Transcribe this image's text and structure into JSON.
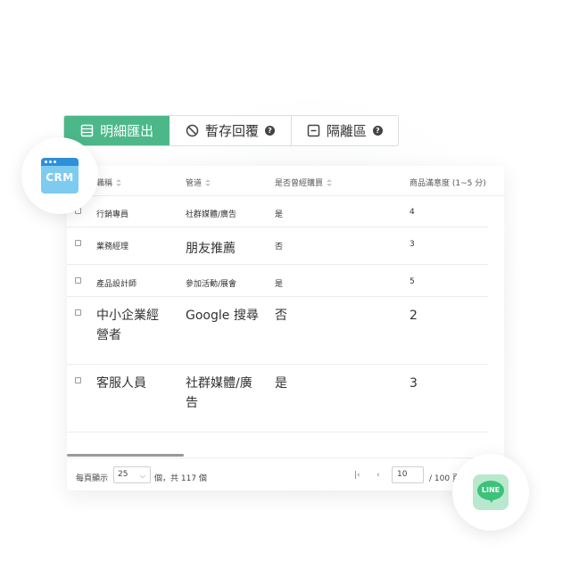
{
  "toolbar": {
    "export_label": "明細匯出",
    "temp_reply_label": "暫存回覆",
    "quarantine_label": "隔離區",
    "help_glyph": "?"
  },
  "table": {
    "columns": [
      "職稱",
      "管道",
      "是否曾經購買",
      "商品滿意度 (1~5 分)"
    ],
    "rows": [
      {
        "title": "行銷專員",
        "channel": "社群媒體/廣告",
        "purchased": "是",
        "rating": "4"
      },
      {
        "title": "業務經理",
        "channel": "朋友推薦",
        "purchased": "否",
        "rating": "3"
      },
      {
        "title": "產品設計師",
        "channel": "參加活動/展會",
        "purchased": "是",
        "rating": "5"
      },
      {
        "title_line1": "中小企業經",
        "title_line2": "營者",
        "channel": "Google 搜尋",
        "purchased": "否",
        "rating": "2"
      },
      {
        "title": "客服人員",
        "channel_line1": "社群媒體/廣",
        "channel_line2": "告",
        "purchased": "是",
        "rating": "3"
      }
    ]
  },
  "pagination": {
    "per_page_label": "每頁顯示",
    "per_page_value": "25",
    "total_label": "個，共 117 個",
    "first_glyph": "|‹",
    "prev_glyph": "‹",
    "current_page": "10",
    "page_total": "/ 100 頁"
  },
  "badges": {
    "crm_label": "CRM",
    "line_label": "LINE"
  },
  "colors": {
    "primary": "#4cb88a",
    "crm_dark": "#2f8fd8",
    "crm_light": "#7ecbf0",
    "line_green": "#3cc27a",
    "line_bg": "#b9e8cf"
  }
}
